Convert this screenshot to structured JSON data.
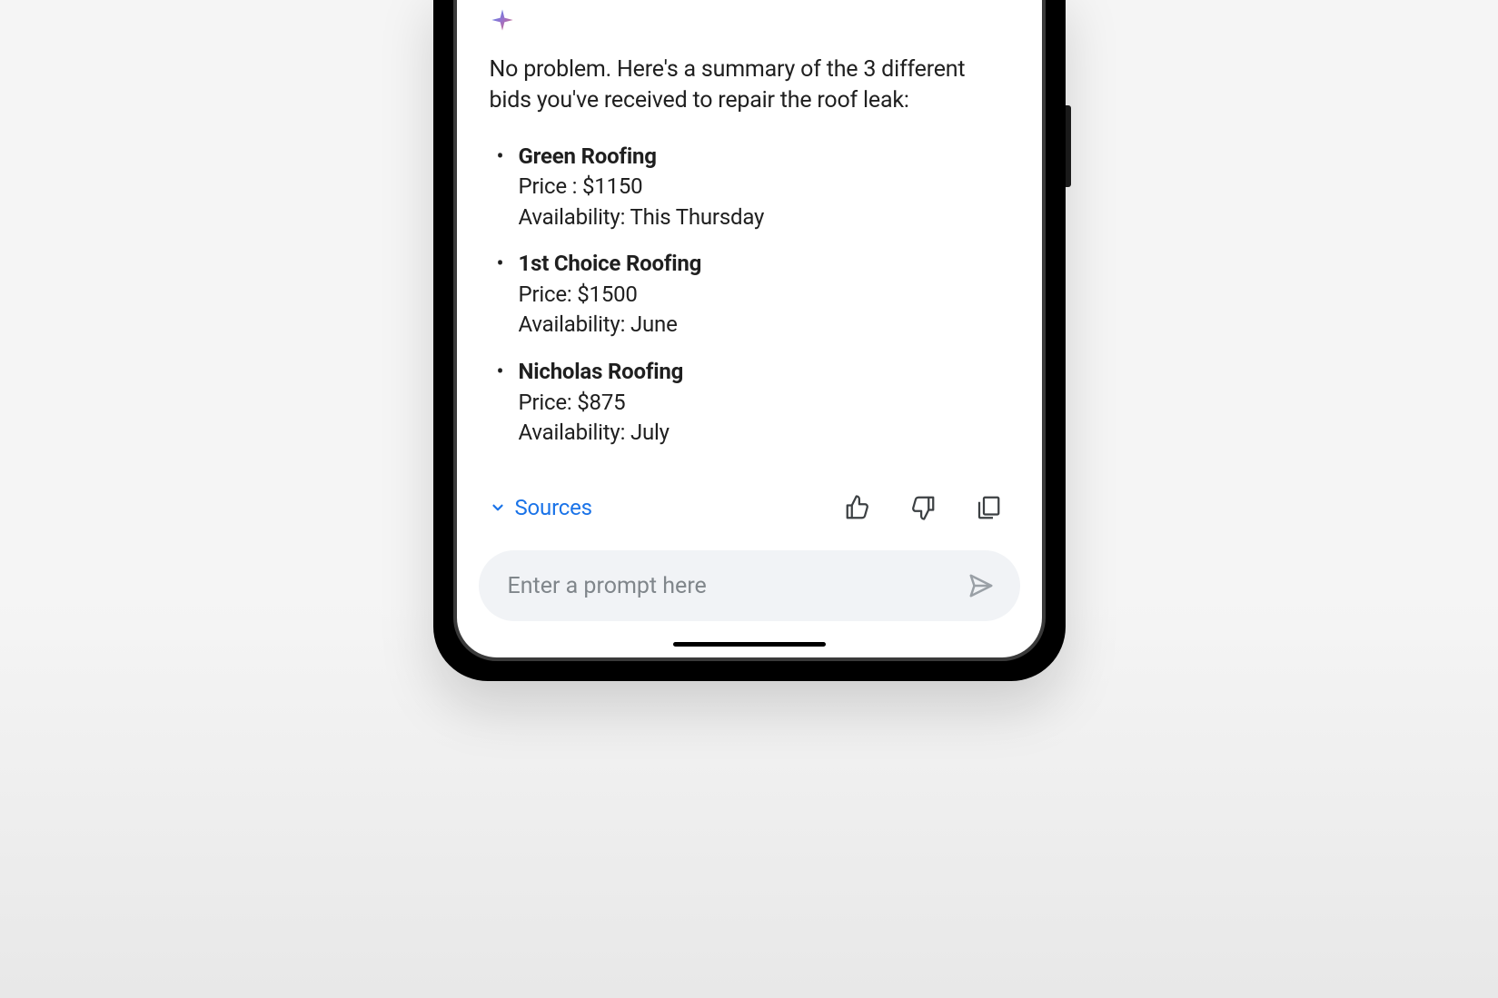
{
  "response": {
    "intro": "No problem. Here's a summary of the 3 different bids you've received to repair the roof leak:",
    "bids": [
      {
        "name": "Green Roofing",
        "price_label": "Price : $1150",
        "availability_label": "Availability: This Thursday"
      },
      {
        "name": "1st Choice Roofing",
        "price_label": "Price: $1500",
        "availability_label": "Availability: June"
      },
      {
        "name": "Nicholas Roofing",
        "price_label": "Price: $875",
        "availability_label": "Availability: July"
      }
    ]
  },
  "footer": {
    "sources_label": "Sources"
  },
  "input": {
    "placeholder": "Enter a prompt here"
  }
}
